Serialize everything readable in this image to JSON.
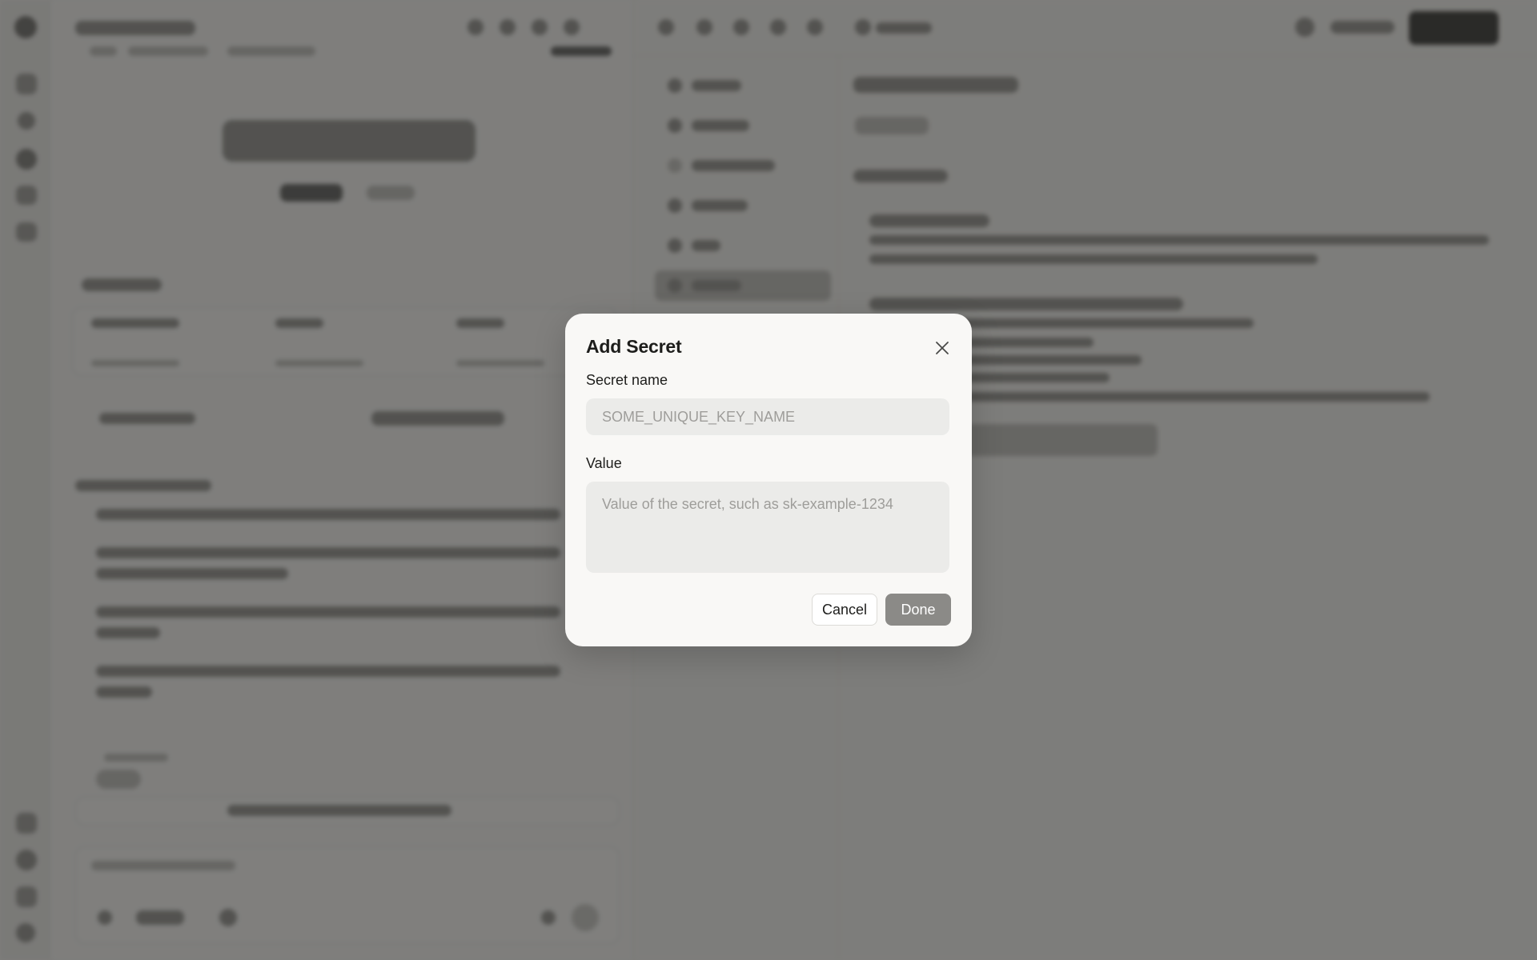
{
  "modal": {
    "title": "Add Secret",
    "close_icon": "close-icon",
    "fields": {
      "name": {
        "label": "Secret name",
        "placeholder": "SOME_UNIQUE_KEY_NAME",
        "value": ""
      },
      "value": {
        "label": "Value",
        "placeholder": "Value of the secret, such as sk-example-1234",
        "value": ""
      }
    },
    "buttons": {
      "cancel": "Cancel",
      "done": "Done"
    }
  },
  "colors": {
    "overlay": "#2a2a28",
    "modal_background": "#f9f8f6",
    "input_background": "#ebebe9",
    "done_button": "#8b8a87"
  }
}
